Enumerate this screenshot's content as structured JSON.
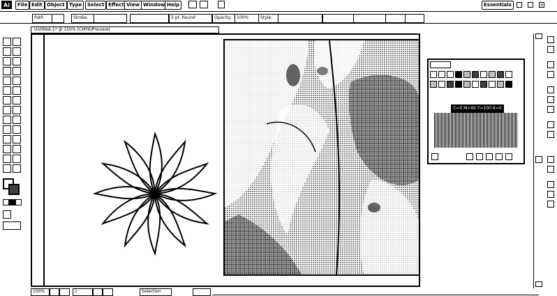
{
  "app": {
    "logo": "Ai",
    "name": "Illustrator"
  },
  "menu": {
    "items": [
      "File",
      "Edit",
      "Object",
      "Type",
      "Select",
      "Effect",
      "View",
      "Window",
      "Help"
    ],
    "right_label": "Essentials"
  },
  "control": {
    "selection_label": "Path",
    "stroke_label": "Stroke:",
    "brush_value": "5 pt. Round",
    "opacity_label": "Opacity:",
    "opacity_value": "100%",
    "style_label": "Style:"
  },
  "document": {
    "tab_title": "Untitled-1* @ 150% (CMYK/Preview)"
  },
  "status": {
    "zoom": "150%",
    "artboard_nav": "1",
    "tool_status": "Selection"
  },
  "color_panel": {
    "tooltip": "C=0 M=95 Y=100 K=0"
  },
  "colors": {
    "ink": "#000000",
    "paper": "#ffffff"
  },
  "icons": {
    "logo": "ai-logo",
    "flower": "flower-artwork",
    "photo": "photo-placed-image"
  }
}
